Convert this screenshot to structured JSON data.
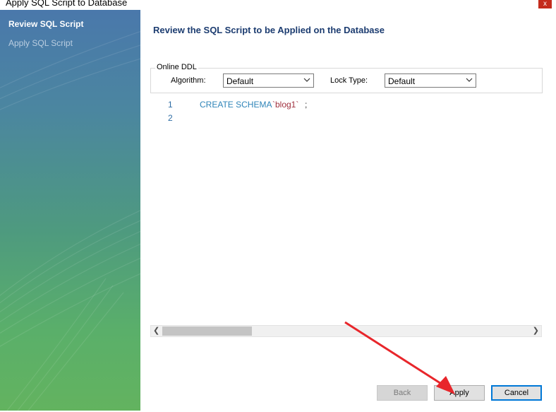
{
  "window": {
    "title": "Apply SQL Script to Database",
    "close_glyph": "x"
  },
  "sidebar": {
    "items": [
      {
        "label": "Review SQL Script",
        "active": true
      },
      {
        "label": "Apply SQL Script",
        "active": false
      }
    ]
  },
  "main": {
    "heading": "Review the SQL Script to be Applied on the Database",
    "online_ddl": {
      "legend": "Online DDL",
      "algorithm_label": "Algorithm:",
      "algorithm_value": "Default",
      "lock_type_label": "Lock Type:",
      "lock_type_value": "Default"
    },
    "script": {
      "lines": [
        {
          "number": "1",
          "keyword": "CREATE SCHEMA",
          "name": "`blog1`",
          "terminator": ";"
        },
        {
          "number": "2"
        }
      ]
    }
  },
  "footer": {
    "back_label": "Back",
    "apply_label": "Apply",
    "cancel_label": "Cancel",
    "back_enabled": false
  },
  "colors": {
    "annotation_arrow": "#e8262b",
    "focus_border": "#0078d7",
    "heading": "#1c3c70"
  }
}
